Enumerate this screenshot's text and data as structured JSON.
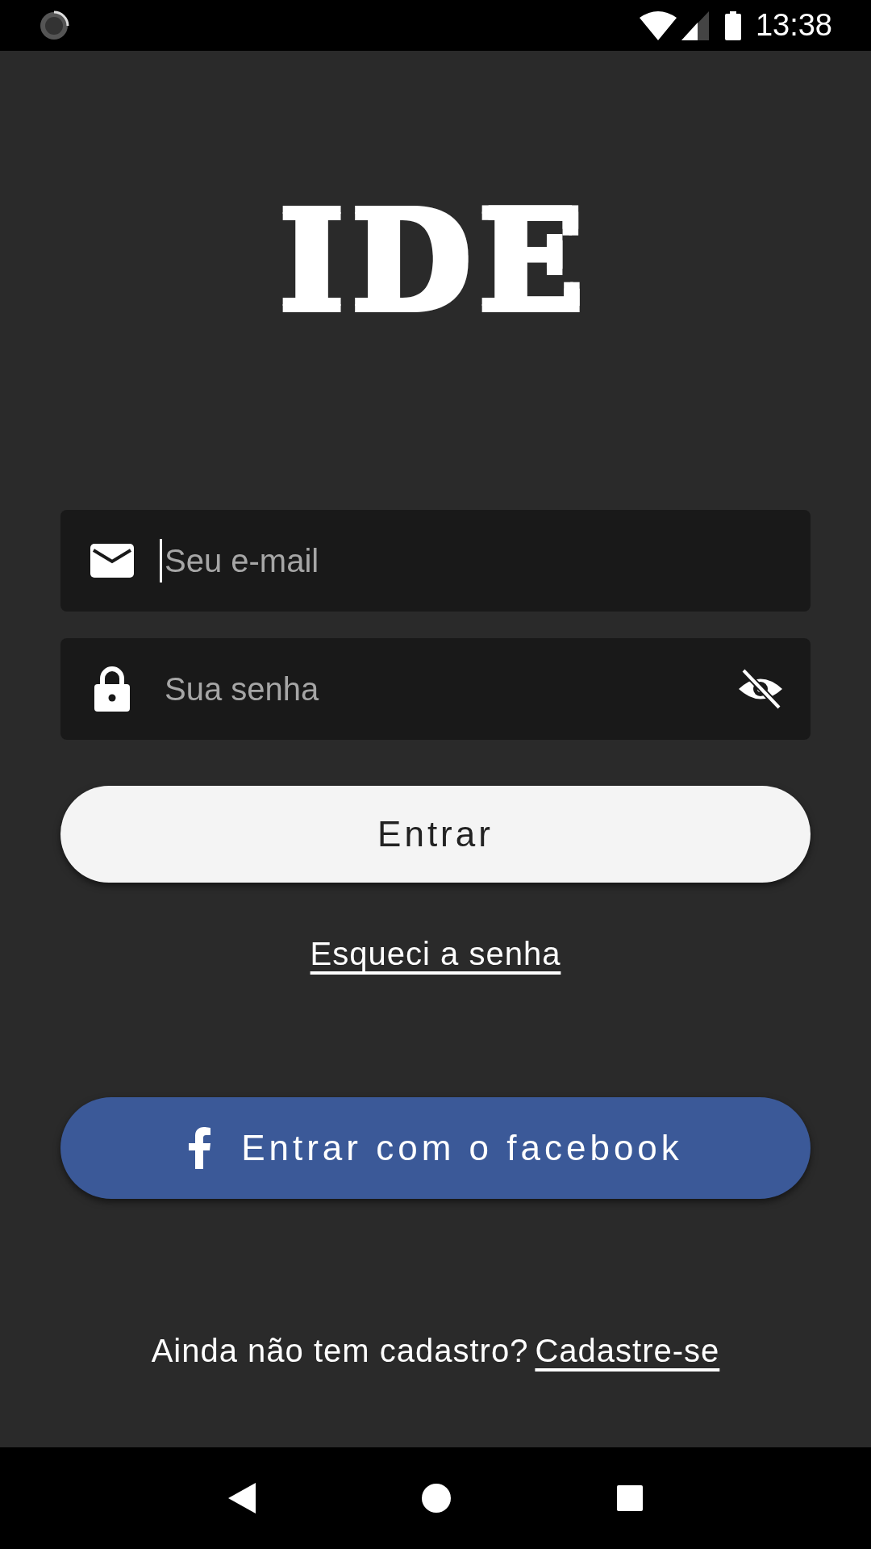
{
  "status_bar": {
    "time": "13:38"
  },
  "logo": {
    "text": "IDE"
  },
  "fields": [
    {
      "kind": "email",
      "placeholder": "Seu e-mail",
      "focused": true
    },
    {
      "kind": "password",
      "placeholder": "Sua senha",
      "focused": false,
      "visible": false
    }
  ],
  "login_button": {
    "label": "Entrar"
  },
  "forgot_link": {
    "label": "Esqueci a senha"
  },
  "facebook_button": {
    "label": "Entrar com o facebook"
  },
  "signup": {
    "prompt": "Ainda não tem cadastro?",
    "link": "Cadastre-se"
  }
}
